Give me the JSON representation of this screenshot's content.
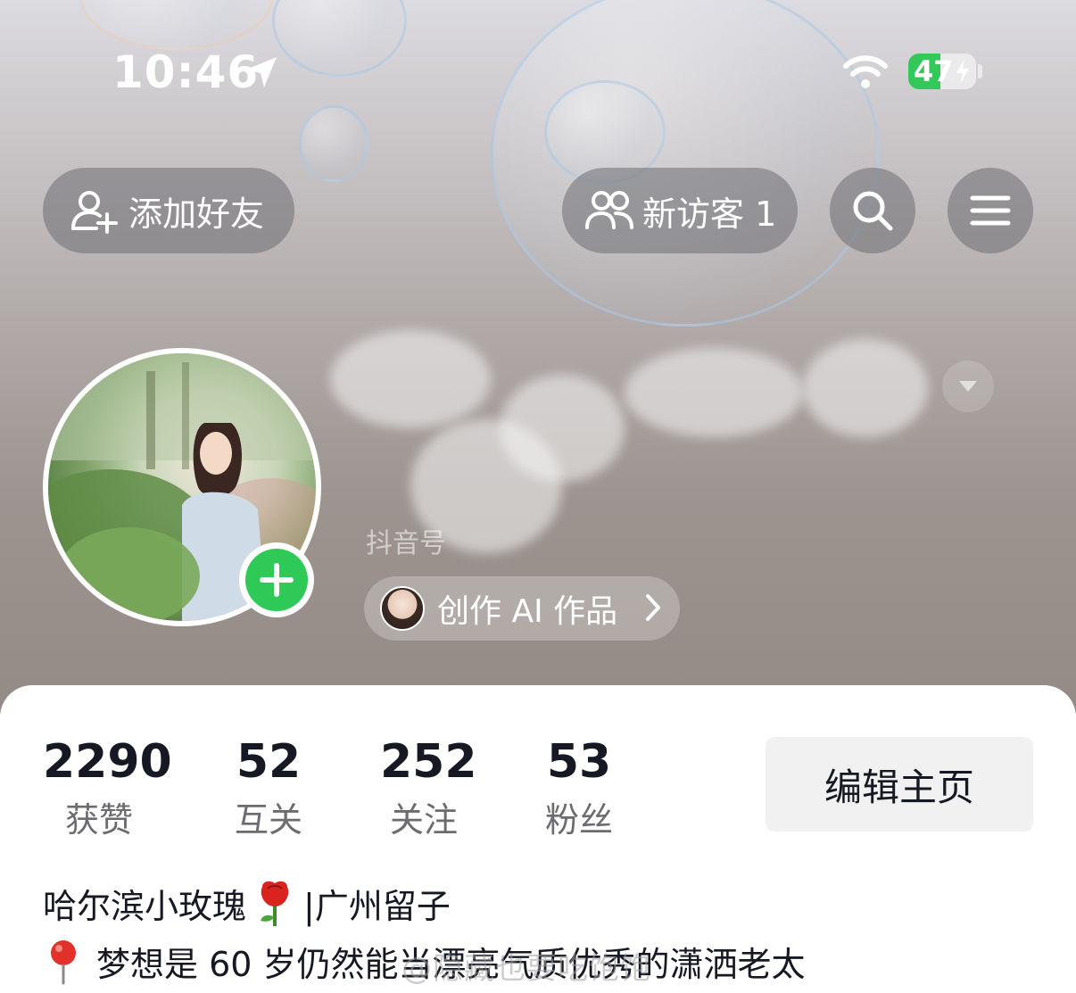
{
  "status_bar": {
    "time": "10:46",
    "battery": "47",
    "battery_level": 0.47,
    "battery_color": "#34c759"
  },
  "top_bar": {
    "add_friend_label": "添加好友",
    "visitors_label": "新访客 1",
    "add_friend_icon": "person-add-icon",
    "visitors_icon": "people-icon",
    "search_icon": "search-icon",
    "menu_icon": "menu-icon"
  },
  "profile": {
    "account_id_label": "抖音号",
    "ai_chip_label": "创作 AI 作品",
    "add_avatar_color": "#2ec956"
  },
  "stats": [
    {
      "value": "2290",
      "label": "获赞"
    },
    {
      "value": "52",
      "label": "互关"
    },
    {
      "value": "252",
      "label": "关注"
    },
    {
      "value": "53",
      "label": "粉丝"
    }
  ],
  "edit_profile_label": "编辑主页",
  "bio": {
    "line1_a": "哈尔滨小玫瑰",
    "line1_b": "|广州留子",
    "line2": "梦想是 60 岁仍然能当漂亮气质优秀的潇洒老太"
  },
  "watermark": "@隐藏也要吃饱饱"
}
